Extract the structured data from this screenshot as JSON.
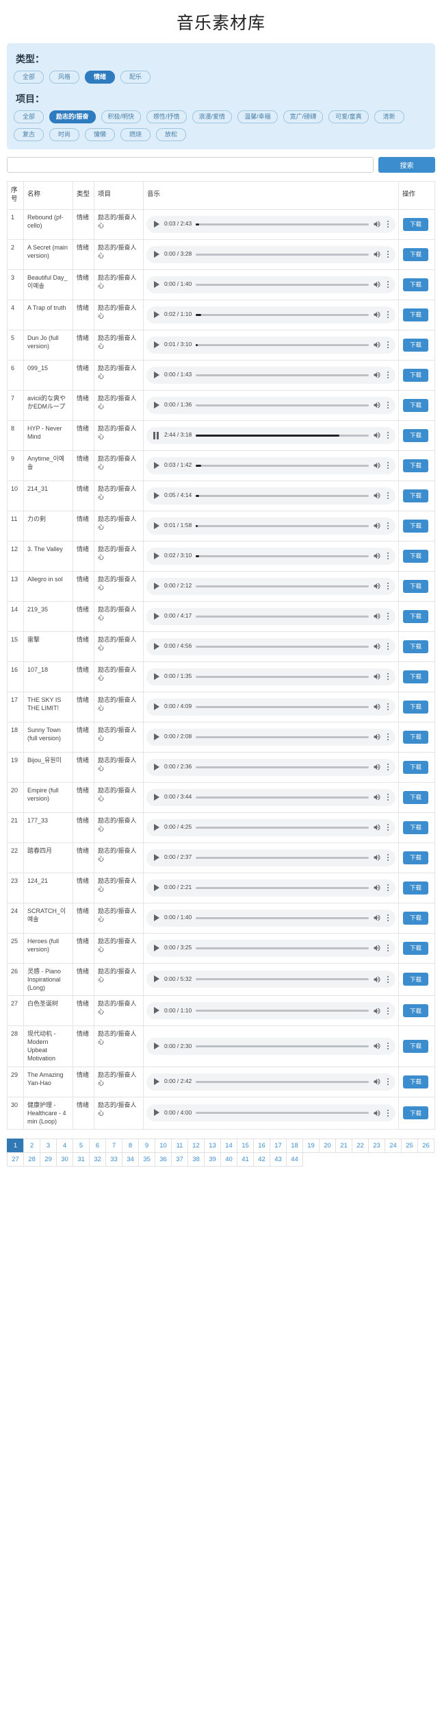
{
  "page_title": "音乐素材库",
  "filters": {
    "type_label": "类型：",
    "type_tags": [
      {
        "label": "全部",
        "active": false
      },
      {
        "label": "风格",
        "active": false
      },
      {
        "label": "情绪",
        "active": true
      },
      {
        "label": "配乐",
        "active": false
      }
    ],
    "project_label": "项目：",
    "project_tags": [
      {
        "label": "全部",
        "active": false
      },
      {
        "label": "励志的/振奋",
        "active": true
      },
      {
        "label": "积极/明快",
        "active": false
      },
      {
        "label": "感性/抒情",
        "active": false
      },
      {
        "label": "浪漫/爱情",
        "active": false
      },
      {
        "label": "温馨/幸福",
        "active": false
      },
      {
        "label": "宽广/磅礴",
        "active": false
      },
      {
        "label": "可爱/童真",
        "active": false
      },
      {
        "label": "清新",
        "active": false
      },
      {
        "label": "复古",
        "active": false
      },
      {
        "label": "时尚",
        "active": false
      },
      {
        "label": "慵懒",
        "active": false
      },
      {
        "label": "燃烧",
        "active": false
      },
      {
        "label": "放松",
        "active": false
      }
    ]
  },
  "search": {
    "value": "",
    "placeholder": "",
    "button_label": "搜索"
  },
  "table": {
    "columns": [
      "序号",
      "名称",
      "类型",
      "项目",
      "音乐",
      "操作"
    ],
    "download_label": "下载",
    "rows": [
      {
        "idx": "1",
        "name": "Rebound (pf-cello)",
        "type": "情绪",
        "project": "励志的/振奋人心",
        "time": "0:03 / 2:43",
        "progress": 2,
        "playing": false
      },
      {
        "idx": "2",
        "name": "A Secret (main version)",
        "type": "情绪",
        "project": "励志的/振奋人心",
        "time": "0:00 / 3:28",
        "progress": 0,
        "playing": false
      },
      {
        "idx": "3",
        "name": "Beautiful Day_이예솔",
        "type": "情绪",
        "project": "励志的/振奋人心",
        "time": "0:00 / 1:40",
        "progress": 0,
        "playing": false
      },
      {
        "idx": "4",
        "name": "A Trap of truth",
        "type": "情绪",
        "project": "励志的/振奋人心",
        "time": "0:02 / 1:10",
        "progress": 3,
        "playing": false
      },
      {
        "idx": "5",
        "name": "Dun Jo (full version)",
        "type": "情绪",
        "project": "励志的/振奋人心",
        "time": "0:01 / 3:10",
        "progress": 1,
        "playing": false
      },
      {
        "idx": "6",
        "name": "099_15",
        "type": "情绪",
        "project": "励志的/振奋人心",
        "time": "0:00 / 1:43",
        "progress": 0,
        "playing": false
      },
      {
        "idx": "7",
        "name": "avicii的な爽やかEDMループ",
        "type": "情绪",
        "project": "励志的/振奋人心",
        "time": "0:00 / 1:36",
        "progress": 0,
        "playing": false
      },
      {
        "idx": "8",
        "name": "HYP - Never Mind",
        "type": "情绪",
        "project": "励志的/振奋人心",
        "time": "2:44 / 3:18",
        "progress": 83,
        "playing": true
      },
      {
        "idx": "9",
        "name": "Anytime_이예솔",
        "type": "情绪",
        "project": "励志的/振奋人心",
        "time": "0:03 / 1:42",
        "progress": 3,
        "playing": false
      },
      {
        "idx": "10",
        "name": "214_31",
        "type": "情绪",
        "project": "励志的/振奋人心",
        "time": "0:05 / 4:14",
        "progress": 2,
        "playing": false
      },
      {
        "idx": "11",
        "name": "力の剣",
        "type": "情绪",
        "project": "励志的/振奋人心",
        "time": "0:01 / 1:58",
        "progress": 1,
        "playing": false
      },
      {
        "idx": "12",
        "name": "3. The Valley",
        "type": "情绪",
        "project": "励志的/振奋人心",
        "time": "0:02 / 3:10",
        "progress": 2,
        "playing": false
      },
      {
        "idx": "13",
        "name": "Allegro in sol",
        "type": "情绪",
        "project": "励志的/振奋人心",
        "time": "0:00 / 2:12",
        "progress": 0,
        "playing": false
      },
      {
        "idx": "14",
        "name": "219_35",
        "type": "情绪",
        "project": "励志的/振奋人心",
        "time": "0:00 / 4:17",
        "progress": 0,
        "playing": false
      },
      {
        "idx": "15",
        "name": "雷撃",
        "type": "情绪",
        "project": "励志的/振奋人心",
        "time": "0:00 / 4:56",
        "progress": 0,
        "playing": false
      },
      {
        "idx": "16",
        "name": "107_18",
        "type": "情绪",
        "project": "励志的/振奋人心",
        "time": "0:00 / 1:35",
        "progress": 0,
        "playing": false
      },
      {
        "idx": "17",
        "name": "THE SKY IS THE LIMIT!",
        "type": "情绪",
        "project": "励志的/振奋人心",
        "time": "0:00 / 4:09",
        "progress": 0,
        "playing": false
      },
      {
        "idx": "18",
        "name": "Sunny Town (full version)",
        "type": "情绪",
        "project": "励志的/振奋人心",
        "time": "0:00 / 2:08",
        "progress": 0,
        "playing": false
      },
      {
        "idx": "19",
        "name": "Bijou_유원미",
        "type": "情绪",
        "project": "励志的/振奋人心",
        "time": "0:00 / 2:36",
        "progress": 0,
        "playing": false
      },
      {
        "idx": "20",
        "name": "Empire (full version)",
        "type": "情绪",
        "project": "励志的/振奋人心",
        "time": "0:00 / 3:44",
        "progress": 0,
        "playing": false
      },
      {
        "idx": "21",
        "name": "177_33",
        "type": "情绪",
        "project": "励志的/振奋人心",
        "time": "0:00 / 4:25",
        "progress": 0,
        "playing": false
      },
      {
        "idx": "22",
        "name": "踏春四月",
        "type": "情绪",
        "project": "励志的/振奋人心",
        "time": "0:00 / 2:37",
        "progress": 0,
        "playing": false
      },
      {
        "idx": "23",
        "name": "124_21",
        "type": "情绪",
        "project": "励志的/振奋人心",
        "time": "0:00 / 2:21",
        "progress": 0,
        "playing": false
      },
      {
        "idx": "24",
        "name": "SCRATCH_이예솔",
        "type": "情绪",
        "project": "励志的/振奋人心",
        "time": "0:00 / 1:40",
        "progress": 0,
        "playing": false
      },
      {
        "idx": "25",
        "name": "Heroes (full version)",
        "type": "情绪",
        "project": "励志的/振奋人心",
        "time": "0:00 / 3:25",
        "progress": 0,
        "playing": false
      },
      {
        "idx": "26",
        "name": "灵感 - Piano Inspirational (Long)",
        "type": "情绪",
        "project": "励志的/振奋人心",
        "time": "0:00 / 5:32",
        "progress": 0,
        "playing": false
      },
      {
        "idx": "27",
        "name": "白色圣诞树",
        "type": "情绪",
        "project": "励志的/振奋人心",
        "time": "0:00 / 1:10",
        "progress": 0,
        "playing": false
      },
      {
        "idx": "28",
        "name": "现代动机 - Modern Upbeat Motivation",
        "type": "情绪",
        "project": "励志的/振奋人心",
        "time": "0:00 / 2:30",
        "progress": 0,
        "playing": false
      },
      {
        "idx": "29",
        "name": "The Amazing Yan-Hao",
        "type": "情绪",
        "project": "励志的/振奋人心",
        "time": "0:00 / 2:42",
        "progress": 0,
        "playing": false
      },
      {
        "idx": "30",
        "name": "健康护理 - Healthcare - 4 min (Loop)",
        "type": "情绪",
        "project": "励志的/振奋人心",
        "time": "0:00 / 4:00",
        "progress": 0,
        "playing": false
      }
    ]
  },
  "pagination": {
    "current": 1,
    "pages": [
      1,
      2,
      3,
      4,
      5,
      6,
      7,
      8,
      9,
      10,
      11,
      12,
      13,
      14,
      15,
      16,
      17,
      18,
      19,
      20,
      21,
      22,
      23,
      24,
      25,
      26,
      27,
      28,
      29,
      30,
      31,
      32,
      33,
      34,
      35,
      36,
      37,
      38,
      39,
      40,
      41,
      42,
      43,
      44
    ]
  },
  "colors": {
    "accent": "#3c8dcd",
    "panel_bg": "#ddeefa",
    "active_tag": "#2e7bbf",
    "pagination_active": "#3079b5"
  }
}
